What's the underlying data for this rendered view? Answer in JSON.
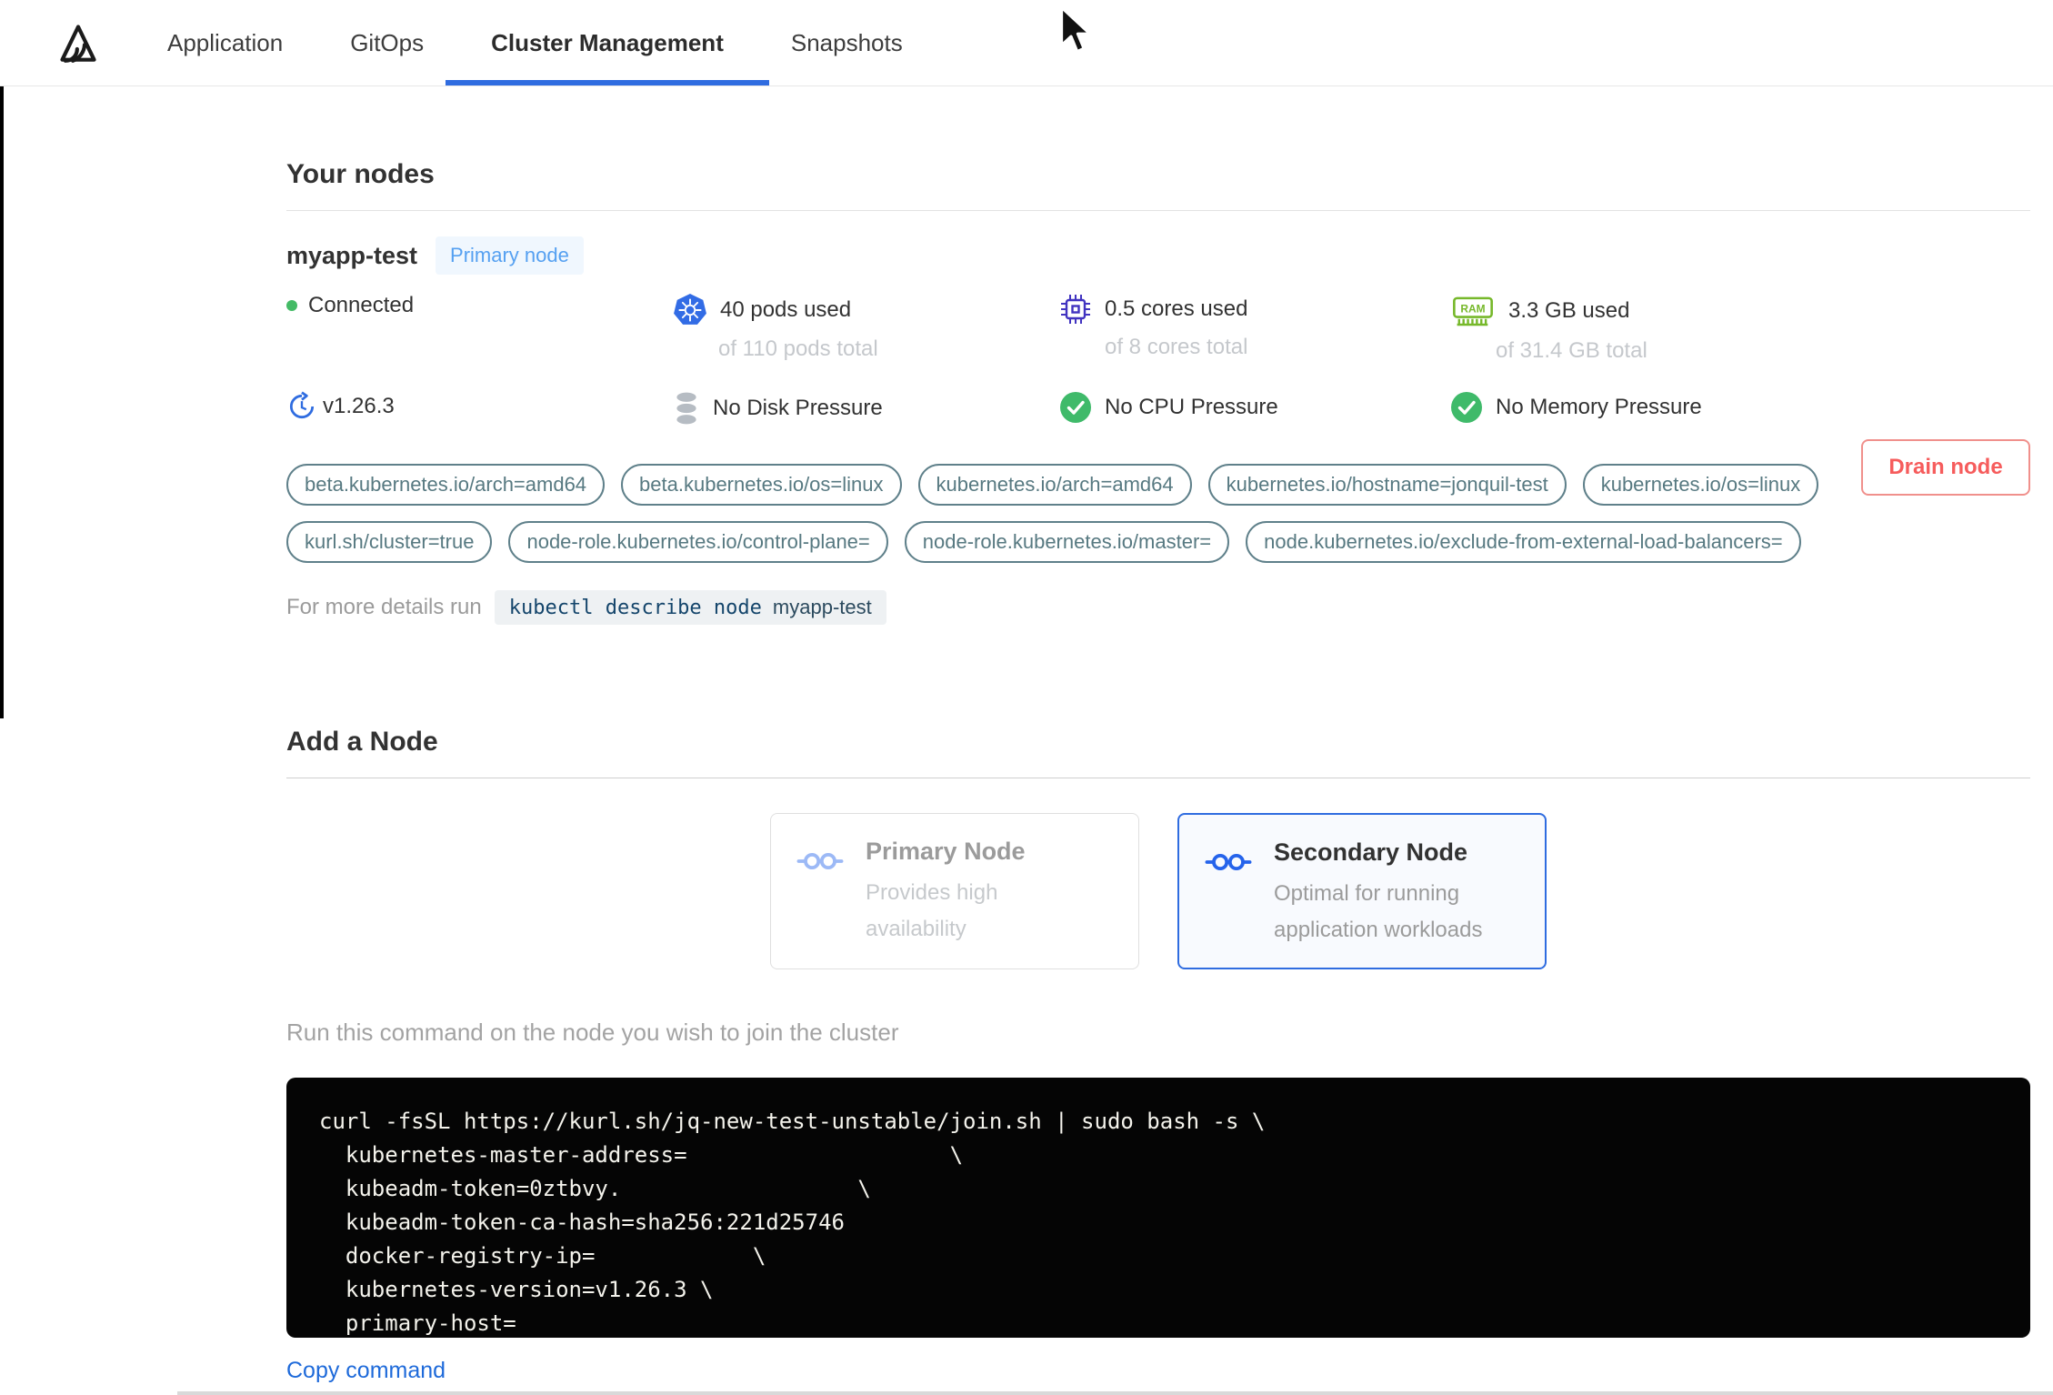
{
  "nav": {
    "tabs": [
      {
        "label": "Application"
      },
      {
        "label": "GitOps"
      },
      {
        "label": "Cluster Management"
      },
      {
        "label": "Snapshots"
      }
    ],
    "active_tab": "Cluster Management"
  },
  "your_nodes": {
    "title": "Your nodes",
    "node": {
      "name": "myapp-test",
      "badge": "Primary node",
      "status": "Connected",
      "stats": [
        {
          "icon": "kubernetes-icon",
          "used": "40 pods used",
          "total": "of 110 pods total"
        },
        {
          "icon": "cpu-icon",
          "used": "0.5 cores used",
          "total": "of 8 cores total"
        },
        {
          "icon": "ram-icon",
          "used": "3.3 GB used",
          "total": "of 31.4 GB total"
        }
      ],
      "conditions": [
        {
          "icon": "version-icon",
          "label": "v1.26.3"
        },
        {
          "icon": "disk-icon",
          "label": "No Disk Pressure"
        },
        {
          "icon": "check-icon",
          "label": "No CPU Pressure"
        },
        {
          "icon": "check-icon",
          "label": "No Memory Pressure"
        }
      ],
      "labels": [
        "beta.kubernetes.io/arch=amd64",
        "beta.kubernetes.io/os=linux",
        "kubernetes.io/arch=amd64",
        "kubernetes.io/hostname=jonquil-test",
        "kubernetes.io/os=linux",
        "kurl.sh/cluster=true",
        "node-role.kubernetes.io/control-plane=",
        "node-role.kubernetes.io/master=",
        "node.kubernetes.io/exclude-from-external-load-balancers="
      ],
      "details_prefix": "For more details run",
      "details_command": "kubectl describe node",
      "details_node": "myapp-test",
      "drain_label": "Drain node"
    }
  },
  "add_node": {
    "title": "Add a Node",
    "cards": [
      {
        "title": "Primary Node",
        "subtitle": "Provides high availability",
        "selected": false
      },
      {
        "title": "Secondary Node",
        "subtitle": "Optimal for running application workloads",
        "selected": true
      }
    ],
    "instruction": "Run this command on the node you wish to join the cluster",
    "command_lines": [
      "curl -fsSL https://kurl.sh/jq-new-test-unstable/join.sh | sudo bash -s \\",
      "  kubernetes-master-address=                    \\",
      "  kubeadm-token=0ztbvy.                  \\",
      "  kubeadm-token-ca-hash=sha256:221d25746",
      "  docker-registry-ip=            \\",
      "  kubernetes-version=v1.26.3 \\",
      "  primary-host="
    ],
    "copy_label": "Copy command"
  },
  "colors": {
    "accent_blue": "#2f6ce0",
    "badge_blue": "#55a0f1",
    "label_teal": "#577981",
    "danger_red": "#f65c5c",
    "success_green": "#3fba6a",
    "kubernetes_blue": "#326ce5",
    "cpu_indigo": "#4133c0",
    "ram_green": "#76b82a",
    "disk_gray": "#b6bcc3"
  }
}
